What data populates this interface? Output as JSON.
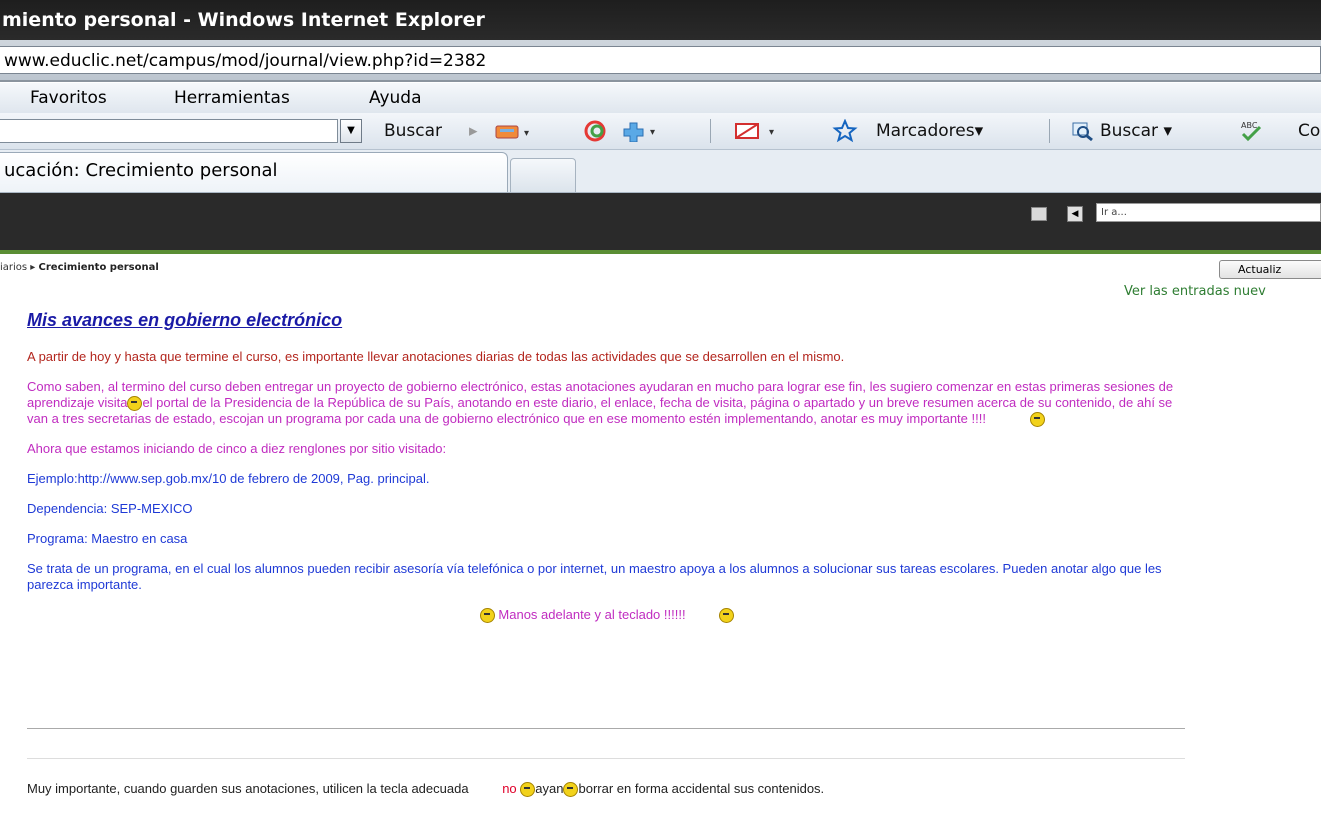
{
  "window": {
    "title": "miento personal - Windows Internet Explorer"
  },
  "address": {
    "url": "www.educlic.net/campus/mod/journal/view.php?id=2382"
  },
  "menu": {
    "items": [
      "Favoritos",
      "Herramientas",
      "Ayuda"
    ]
  },
  "toolbar": {
    "buscar_label": "Buscar",
    "marcadores_label": "Marcadores",
    "buscar2_label": "Buscar",
    "co_label": "Co"
  },
  "tabs": {
    "active_label": "ucación: Crecimiento personal"
  },
  "header": {
    "goto_placeholder": "Ir a..."
  },
  "breadcrumb": {
    "prefix": "iarios ▸ ",
    "current": "Crecimiento personal"
  },
  "actions": {
    "refresh_label": "Actualiz",
    "view_new_link": "Ver las entradas nuev"
  },
  "entry": {
    "title": "Mis avances en gobierno electrónico",
    "p1": "A partir de hoy y hasta que termine el curso, es importante llevar anotaciones diarias de todas las actividades que se desarrollen en el mismo.",
    "p2a": " Como saben, al termino del curso  deben entregar un proyecto de gobierno electrónico, estas anotaciones ayudaran en mucho para lograr ese fin, les sugiero comenzar en estas primeras sesiones de aprendizaje  visita",
    "p2b": "el portal de la Presidencia de la República de su País, anotando en este diario, el enlace, fecha de visita, página o apartado y un breve resumen acerca de su contenido, de ahí se van a tres secretarias de estado, escojan un programa por cada una de gobierno electrónico que en ese momento estén implementando, anotar es muy importante !!!!",
    "p3": "Ahora que estamos iniciando de cinco a diez renglones por sitio visitado:",
    "p4": "Ejemplo:http://www.sep.gob.mx/10 de febrero de 2009, Pag. principal.",
    "p5": "Dependencia: SEP-MEXICO",
    "p6": "Programa: Maestro en casa",
    "p7": "Se trata de un programa, en el cual los alumnos pueden recibir asesoría vía telefónica o por internet, un maestro  apoya a los alumnos a solucionar sus tareas escolares. Pueden anotar algo que les parezca importante.",
    "p8": "Manos adelante y al teclado !!!!!!"
  },
  "footer": {
    "text_a": "Muy importante, cuando guarden sus anotaciones, utilicen la tecla adecuada",
    "no": "no",
    "text_b": "ayan",
    "text_c": "borrar en forma accidental sus contenidos."
  }
}
